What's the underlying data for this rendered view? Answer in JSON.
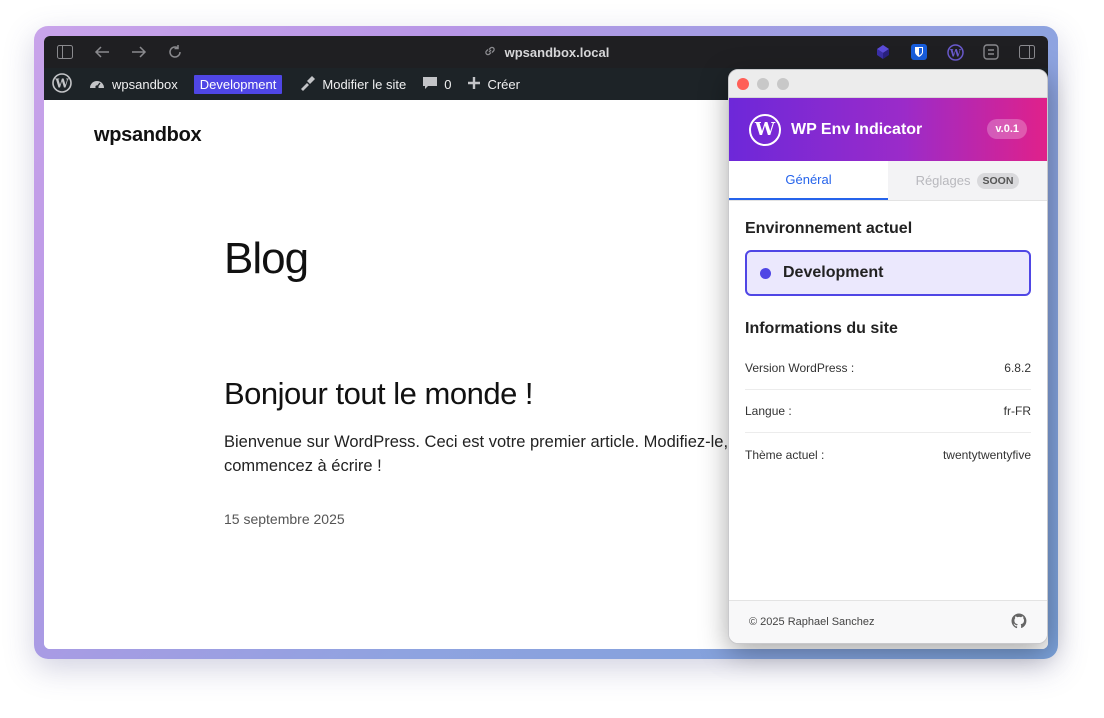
{
  "browser": {
    "url": "wpsandbox.local",
    "toolbar_icons": [
      "sidebar-icon",
      "back-icon",
      "forward-icon",
      "reload-icon",
      "link-icon",
      "extension-icon",
      "bitwarden-icon",
      "wordpress-icon",
      "tab-icon",
      "split-view-icon"
    ]
  },
  "admin_bar": {
    "site_name": "wpsandbox",
    "env_badge": "Development",
    "customize": "Modifier le site",
    "comments_count": "0",
    "new_label": "Créer"
  },
  "page": {
    "site_title": "wpsandbox",
    "heading": "Blog",
    "post_title": "Bonjour tout le monde !",
    "post_excerpt": "Bienvenue sur WordPress. Ceci est votre premier article. Modifiez-le, puis commencez à écrire !",
    "post_date": "15 septembre 2025"
  },
  "popup": {
    "name": "WP Env Indicator",
    "version": "v.0.1",
    "tabs": [
      {
        "label": "Général",
        "active": true
      },
      {
        "label": "Réglages",
        "badge": "SOON",
        "active": false
      }
    ],
    "current_env_heading": "Environnement actuel",
    "current_env": "Development",
    "info_heading": "Informations du site",
    "info": [
      {
        "label": "Version WordPress :",
        "value": "6.8.2"
      },
      {
        "label": "Langue :",
        "value": "fr-FR"
      },
      {
        "label": "Thème actuel :",
        "value": "twentytwentyfive"
      }
    ],
    "footer": "© 2025 Raphael Sanchez"
  },
  "colors": {
    "env_accent": "#4f46e5",
    "env_bg": "#ebe8fd",
    "header_gradient_start": "#6d28d9",
    "header_gradient_end": "#e0218a",
    "tab_active": "#2563eb",
    "admin_bar": "#1d2327"
  }
}
